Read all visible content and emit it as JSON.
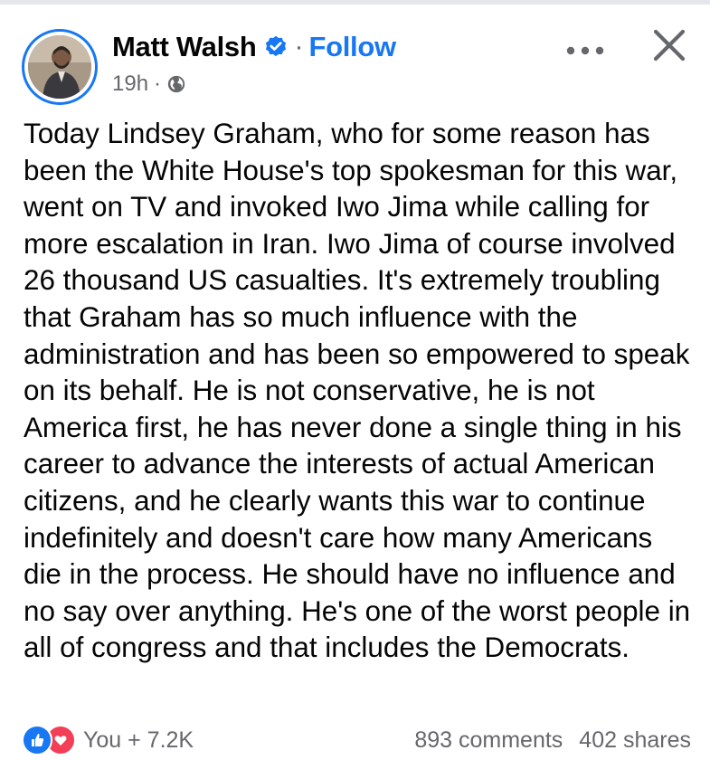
{
  "post": {
    "author": "Matt Walsh",
    "separator": "·",
    "follow_label": "Follow",
    "time": "19h",
    "meta_separator": "·",
    "privacy_icon": "globe-icon",
    "more_icon": "more-horizontal-icon",
    "close_icon": "close-icon",
    "verified_icon": "verified-badge-icon",
    "body": "Today Lindsey Graham, who for some reason has been the White House's top spokesman for this war, went on TV and invoked Iwo Jima while calling for more escalation in Iran. Iwo Jima of course involved 26 thousand US casualties. It's extremely troubling that Graham has so much influence with the administration and has been so empowered to speak on its behalf. He is not conservative, he is not America first, he has never done a single thing in his career to advance the interests of actual American citizens, and he clearly wants this war to continue indefinitely and doesn't care how many Americans die in the process. He should have no influence and no say over anything. He's one of the worst people in all of congress and that includes the Democrats.",
    "reactions_label": "You + 7.2K",
    "reaction_icons": [
      "like-icon",
      "love-icon"
    ],
    "comments": "893 comments",
    "shares": "402 shares"
  },
  "colors": {
    "accent": "#1877f2",
    "text": "#050505",
    "secondary_text": "#65676b",
    "love": "#f33e58"
  }
}
